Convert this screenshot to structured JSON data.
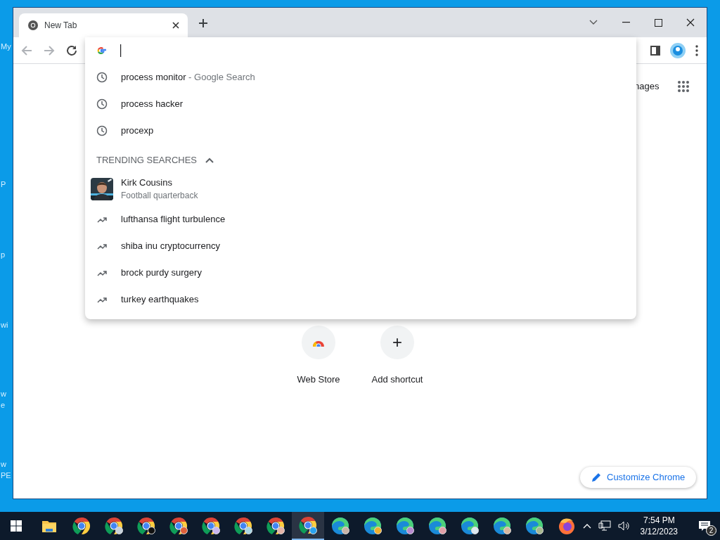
{
  "desktop": {
    "icon_labels": [
      [
        "My"
      ],
      [
        "P"
      ],
      [
        "p"
      ],
      [
        "wi"
      ],
      [
        "w",
        "e"
      ],
      [
        "w",
        "PE"
      ]
    ]
  },
  "browser": {
    "tabs": [
      {
        "title": "New Tab",
        "selected": true
      }
    ],
    "suggestions": [
      {
        "kind": "history",
        "text": "process monitor",
        "suffix": "- Google Search"
      },
      {
        "kind": "history",
        "text": "process hacker"
      },
      {
        "kind": "history",
        "text": "procexp"
      }
    ],
    "trending_header": "TRENDING SEARCHES",
    "trending_expanded": true,
    "trending": [
      {
        "kind": "entity",
        "title": "Kirk Cousins",
        "subtitle": "Football quarterback"
      },
      {
        "kind": "trend",
        "text": "lufthansa flight turbulence"
      },
      {
        "kind": "trend",
        "text": "shiba inu cryptocurrency"
      },
      {
        "kind": "trend",
        "text": "brock purdy surgery"
      },
      {
        "kind": "trend",
        "text": "turkey earthquakes"
      }
    ],
    "new_tab_page": {
      "images_link": "nages",
      "shortcuts": [
        {
          "kind": "store",
          "label": "Web Store"
        },
        {
          "kind": "add",
          "icon": "+",
          "label": "Add shortcut"
        }
      ],
      "customize": "Customize Chrome"
    }
  },
  "taskbar": {
    "apps": [
      {
        "kind": "folder",
        "selected": false
      },
      {
        "kind": "chrome",
        "selected": false
      },
      {
        "kind": "chrome",
        "selected": false,
        "color": "#c7d2dc"
      },
      {
        "kind": "chrome",
        "selected": false,
        "color": "#111111"
      },
      {
        "kind": "chrome",
        "selected": false,
        "color": "#e0603a"
      },
      {
        "kind": "chrome",
        "selected": false,
        "color": "#c9b6f0"
      },
      {
        "kind": "chrome",
        "selected": false,
        "color": "#a9d7e6"
      },
      {
        "kind": "chrome",
        "selected": false,
        "color": "#e4b4a8"
      },
      {
        "kind": "chrome",
        "selected": true,
        "color": "#2aa3f0"
      },
      {
        "kind": "edge",
        "selected": false,
        "color": "#c8b4a8"
      },
      {
        "kind": "edge",
        "selected": false,
        "color": "#f0b030"
      },
      {
        "kind": "edge",
        "selected": false,
        "color": "#b68ad0"
      },
      {
        "kind": "edge",
        "selected": false,
        "color": "#e0a0a8"
      },
      {
        "kind": "edge",
        "selected": false,
        "color": "#dce8f0"
      },
      {
        "kind": "edge",
        "selected": false,
        "color": "#d8b8a0"
      },
      {
        "kind": "edge",
        "selected": false,
        "color": "#a8b890"
      },
      {
        "kind": "firefox",
        "selected": false
      }
    ],
    "time": "7:54 PM",
    "date": "3/12/2023",
    "notifications": "2"
  }
}
